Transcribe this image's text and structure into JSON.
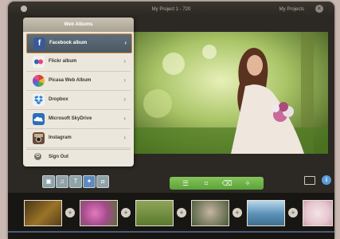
{
  "window": {
    "title": "My Project 1 - 720",
    "user": "My Projects",
    "close_glyph": "×"
  },
  "menu": {
    "header": "Web Albums",
    "items": [
      {
        "label": "Facebook album",
        "icon": "facebook-icon",
        "color": "#3b5998",
        "selected": true
      },
      {
        "label": "Flickr album",
        "icon": "flickr-icon",
        "color": "#e7457d",
        "selected": false
      },
      {
        "label": "Picasa Web Album",
        "icon": "picasa-icon",
        "color": "#d9a13a",
        "selected": false
      },
      {
        "label": "Dropbox",
        "icon": "dropbox-icon",
        "color": "#2f7fd0",
        "selected": false
      },
      {
        "label": "Microsoft SkyDrive",
        "icon": "skydrive-icon",
        "color": "#2a6fb8",
        "selected": false
      },
      {
        "label": "Instagram",
        "icon": "instagram-icon",
        "color": "#6b4b3a",
        "selected": false
      }
    ],
    "chevron": "›",
    "sign_out": "Sign Out"
  },
  "toolbar": {
    "media_tabs": [
      "photo-tab-icon",
      "music-tab-icon",
      "text-tab-icon",
      "effects-tab-icon",
      "transition-tab-icon"
    ],
    "edit_tools": [
      "list-icon",
      "crop-icon",
      "trash-icon",
      "magic-wand-icon"
    ],
    "accent": "#5aa338"
  },
  "filmstrip": {
    "add_glyph": "+",
    "thumbs": [
      {
        "name": "autumn-leaves-thumb",
        "color": "#7a5a26"
      },
      {
        "name": "pink-flowers-thumb",
        "color": "#b85a9c"
      },
      {
        "name": "green-field-thumb",
        "color": "#6c8a3a"
      },
      {
        "name": "child-portrait-thumb",
        "color": "#8a8a70"
      },
      {
        "name": "seaside-thumb",
        "color": "#5b8fb5"
      },
      {
        "name": "blossom-thumb",
        "color": "#e6c6cf"
      }
    ]
  }
}
